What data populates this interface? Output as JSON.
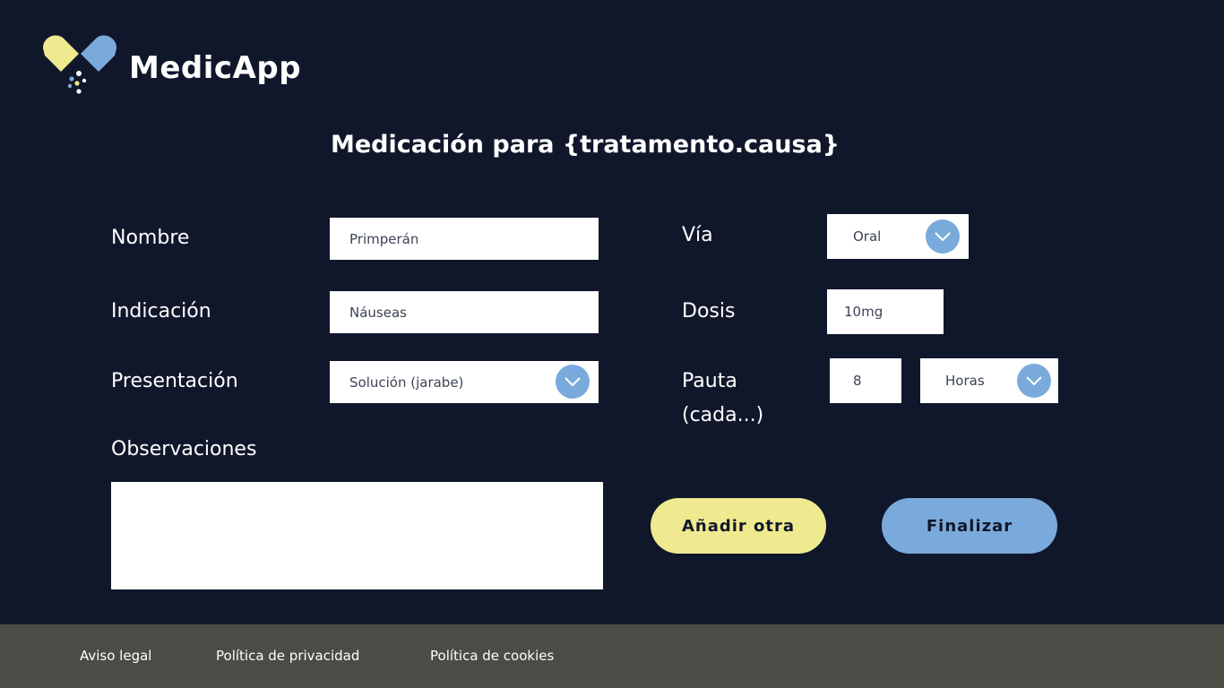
{
  "brand": {
    "name": "MedicApp"
  },
  "page": {
    "title": "Medicación para {tratamento.causa}"
  },
  "form": {
    "nombre": {
      "label": "Nombre",
      "value": "Primperán"
    },
    "indicacion": {
      "label": "Indicación",
      "value": "Náuseas"
    },
    "presentacion": {
      "label": "Presentación",
      "value": "Solución (jarabe)"
    },
    "observaciones": {
      "label": "Observaciones",
      "value": ""
    },
    "via": {
      "label": "Vía",
      "value": "Oral"
    },
    "dosis": {
      "label": "Dosis",
      "value": "10mg"
    },
    "pauta": {
      "label_line1": "Pauta",
      "label_line2": "(cada...)",
      "value": "8",
      "unit": "Horas"
    }
  },
  "actions": {
    "add_label": "Añadir otra",
    "finish_label": "Finalizar"
  },
  "footer": {
    "links": [
      "Aviso legal",
      "Política de privacidad",
      "Política de cookies"
    ]
  },
  "colors": {
    "background": "#11172b",
    "accent_yellow": "#efe98f",
    "accent_blue": "#7aaadb",
    "footer": "#4a4c45"
  },
  "icons": {
    "dropdown": "chevron-down-icon",
    "logo": "pill-logo-icon"
  }
}
